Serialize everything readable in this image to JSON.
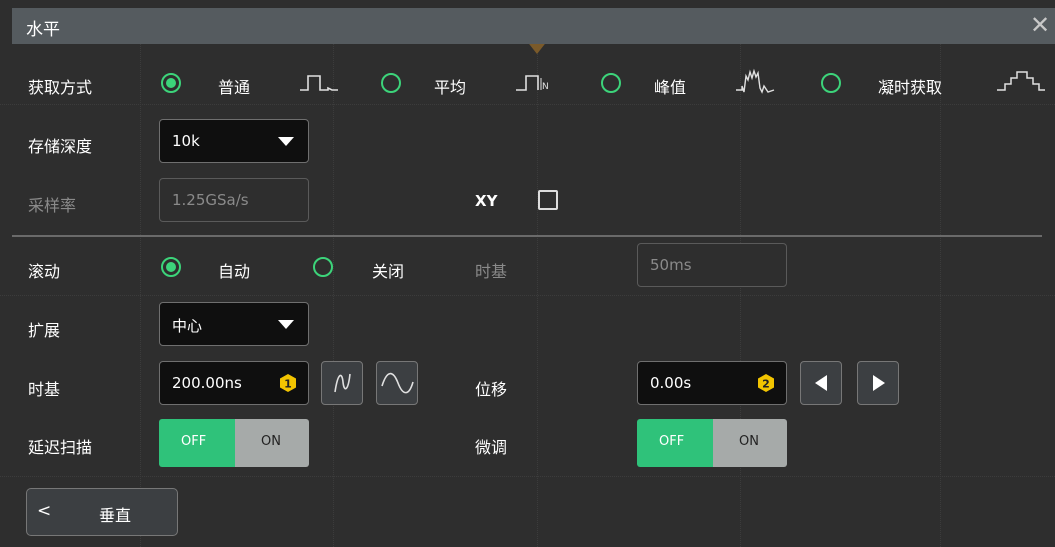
{
  "window": {
    "title": "水平",
    "close_icon": "close-icon"
  },
  "acquisition": {
    "label": "获取方式",
    "options": [
      {
        "label": "普通",
        "selected": true,
        "icon": "normal-wave-icon"
      },
      {
        "label": "平均",
        "selected": false,
        "icon": "average-wave-icon"
      },
      {
        "label": "峰值",
        "selected": false,
        "icon": "peak-wave-icon"
      },
      {
        "label": "凝时获取",
        "selected": false,
        "icon": "hires-wave-icon"
      }
    ]
  },
  "memory_depth": {
    "label": "存储深度",
    "value": "10k"
  },
  "sample_rate": {
    "label": "采样率",
    "value": "1.25GSa/s"
  },
  "xy": {
    "label": "XY",
    "checked": false
  },
  "roll": {
    "label": "滚动",
    "options": [
      {
        "label": "自动",
        "selected": true
      },
      {
        "label": "关闭",
        "selected": false
      }
    ],
    "timebase_label": "时基",
    "timebase_value": "50ms"
  },
  "expand": {
    "label": "扩展",
    "value": "中心"
  },
  "timebase": {
    "label": "时基",
    "value": "200.00ns",
    "knob": "1"
  },
  "offset": {
    "label": "位移",
    "value": "0.00s",
    "knob": "2"
  },
  "delay_scan": {
    "label": "延迟扫描",
    "off_label": "OFF",
    "on_label": "ON",
    "state": "OFF"
  },
  "fine": {
    "label": "微调",
    "off_label": "OFF",
    "on_label": "ON",
    "state": "OFF"
  },
  "back": {
    "chevron": "<",
    "label": "垂直"
  },
  "colors": {
    "accent": "#3cd47a",
    "toggle_on": "#2fc27a",
    "knob": "#f2c400",
    "title_bar": "#555b5f"
  }
}
